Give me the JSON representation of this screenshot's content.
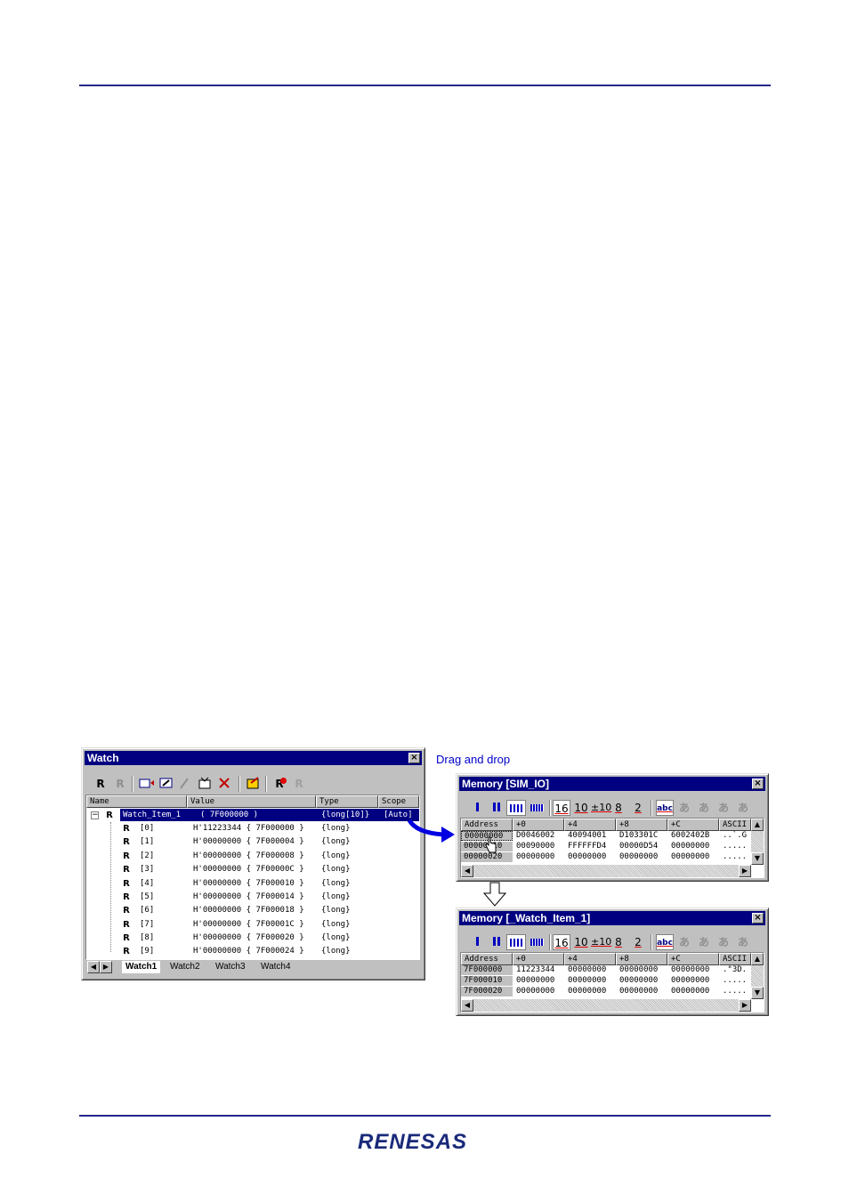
{
  "caption": "Drag and drop",
  "logo": "RENESAS",
  "watch": {
    "title": "Watch",
    "close": "×",
    "columns": [
      "Name",
      "Value",
      "Type",
      "Scope"
    ],
    "root": {
      "name": "Watch_Item_1",
      "value": "( 7F000000 )",
      "type": "{long[10]}",
      "scope": "[Auto]"
    },
    "items": [
      {
        "name": "[0]",
        "value": "H'11223344 { 7F000000 }",
        "type": "{long}"
      },
      {
        "name": "[1]",
        "value": "H'00000000 { 7F000004 }",
        "type": "{long}"
      },
      {
        "name": "[2]",
        "value": "H'00000000 { 7F000008 }",
        "type": "{long}"
      },
      {
        "name": "[3]",
        "value": "H'00000000 { 7F00000C }",
        "type": "{long}"
      },
      {
        "name": "[4]",
        "value": "H'00000000 { 7F000010 }",
        "type": "{long}"
      },
      {
        "name": "[5]",
        "value": "H'00000000 { 7F000014 }",
        "type": "{long}"
      },
      {
        "name": "[6]",
        "value": "H'00000000 { 7F000018 }",
        "type": "{long}"
      },
      {
        "name": "[7]",
        "value": "H'00000000 { 7F00001C }",
        "type": "{long}"
      },
      {
        "name": "[8]",
        "value": "H'00000000 { 7F000020 }",
        "type": "{long}"
      },
      {
        "name": "[9]",
        "value": "H'00000000 { 7F000024 }",
        "type": "{long}"
      }
    ],
    "tabs": [
      "Watch1",
      "Watch2",
      "Watch3",
      "Watch4"
    ]
  },
  "memory1": {
    "title": "Memory [SIM_IO]",
    "close": "×",
    "toolbar": [
      "16",
      "10",
      "±10",
      "8",
      "2",
      "abc",
      "あ",
      "あ",
      "あ",
      "あ"
    ],
    "columns": [
      "Address",
      "+0",
      "+4",
      "+8",
      "+C",
      "ASCII"
    ],
    "rows": [
      [
        "00000000",
        "D0046002",
        "40094001",
        "D103301C",
        "6002402B",
        "..`.G"
      ],
      [
        "00000010",
        "00090000",
        "FFFFFFD4",
        "00000D54",
        "00000000",
        "....."
      ],
      [
        "00000020",
        "00000000",
        "00000000",
        "00000000",
        "00000000",
        "....."
      ]
    ]
  },
  "memory2": {
    "title": "Memory [_Watch_Item_1]",
    "close": "×",
    "toolbar": [
      "16",
      "10",
      "±10",
      "8",
      "2",
      "abc",
      "あ",
      "あ",
      "あ",
      "あ"
    ],
    "columns": [
      "Address",
      "+0",
      "+4",
      "+8",
      "+C",
      "ASCII"
    ],
    "rows": [
      [
        "7F000000",
        "11223344",
        "00000000",
        "00000000",
        "00000000",
        ".\"3D."
      ],
      [
        "7F000010",
        "00000000",
        "00000000",
        "00000000",
        "00000000",
        "....."
      ],
      [
        "7F000020",
        "00000000",
        "00000000",
        "00000000",
        "00000000",
        "....."
      ]
    ]
  },
  "icons": {
    "r": "R",
    "rgray": "R",
    "arrow_right": "→",
    "arrow_down": "⇩"
  }
}
